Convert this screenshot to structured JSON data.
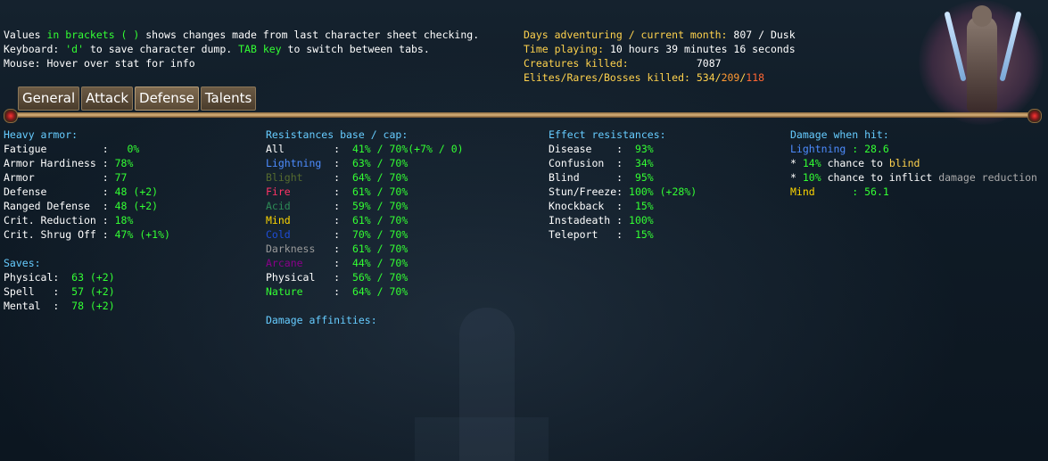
{
  "info": {
    "line1_a": "Values ",
    "line1_b": "in brackets ( )",
    "line1_c": " shows changes made from last character sheet checking.",
    "line2_a": "Keyboard: ",
    "line2_b": "'d'",
    "line2_c": " to save character dump. ",
    "line2_d": "TAB key",
    "line2_e": " to switch between tabs.",
    "line3": "Mouse: Hover over stat for info"
  },
  "stats": {
    "days_label": "Days adventuring / current month:",
    "days_value": " 807 / Dusk",
    "time_label": "Time playing:",
    "time_value": " 10 hours 39 minutes 16 seconds",
    "kills_label": "Creatures killed:",
    "kills_value": "           7087",
    "elites_label": "Elites/Rares/Bosses killed:",
    "elites_value": " 534",
    "rares_value": "209",
    "bosses_value": "118",
    "slash": "/"
  },
  "tabs": [
    {
      "label": "General"
    },
    {
      "label": "Attack"
    },
    {
      "label": "Defense"
    },
    {
      "label": "Talents"
    }
  ],
  "armor": {
    "heading": "Heavy armor:",
    "rows": [
      {
        "label": "Fatigue         :",
        "value": "   0%"
      },
      {
        "label": "Armor Hardiness :",
        "value": " 78%"
      },
      {
        "label": "Armor           :",
        "value": " 77"
      },
      {
        "label": "Defense         :",
        "value": " 48 (+2)"
      },
      {
        "label": "Ranged Defense  :",
        "value": " 48 (+2)"
      },
      {
        "label": "Crit. Reduction :",
        "value": " 18%"
      },
      {
        "label": "Crit. Shrug Off :",
        "value": " 47% (+1%)"
      }
    ]
  },
  "saves": {
    "heading": "Saves:",
    "rows": [
      {
        "label": "Physical:",
        "value": "  63 (+2)"
      },
      {
        "label": "Spell   :",
        "value": "  57 (+2)"
      },
      {
        "label": "Mental  :",
        "value": "  78 (+2)"
      }
    ]
  },
  "resistances": {
    "heading": "Resistances base / cap:",
    "rows": [
      {
        "label": "All",
        "sep": "        :",
        "value": "  41% / 70%(+7% / 0)",
        "color": "#ffffff"
      },
      {
        "label": "Lightning",
        "sep": "  :",
        "value": "  63% / 70%",
        "color": "#4d8cff"
      },
      {
        "label": "Blight",
        "sep": "     :",
        "value": "  64% / 70%",
        "color": "#556b2f"
      },
      {
        "label": "Fire",
        "sep": "       :",
        "value": "  61% / 70%",
        "color": "#ff3366"
      },
      {
        "label": "Acid",
        "sep": "       :",
        "value": "  59% / 70%",
        "color": "#2e8b57"
      },
      {
        "label": "Mind",
        "sep": "       :",
        "value": "  61% / 70%",
        "color": "#ffd700"
      },
      {
        "label": "Cold",
        "sep": "       :",
        "value": "  70% / 70%",
        "color": "#1e4dd8"
      },
      {
        "label": "Darkness",
        "sep": "   :",
        "value": "  61% / 70%",
        "color": "#9a9a9a"
      },
      {
        "label": "Arcane",
        "sep": "     :",
        "value": "  44% / 70%",
        "color": "#8b008b"
      },
      {
        "label": "Physical",
        "sep": "   :",
        "value": "  56% / 70%",
        "color": "#ffffff"
      },
      {
        "label": "Nature",
        "sep": "     :",
        "value": "  64% / 70%",
        "color": "#33ff33"
      }
    ],
    "affinities_heading": "Damage affinities:"
  },
  "effects": {
    "heading": "Effect resistances:",
    "rows": [
      {
        "label": "Disease    :",
        "value": "  93%"
      },
      {
        "label": "Confusion  :",
        "value": "  34%"
      },
      {
        "label": "Blind      :",
        "value": "  95%"
      },
      {
        "label": "Stun/Freeze:",
        "value": " 100% (+28%)"
      },
      {
        "label": "Knockback  :",
        "value": "  15%"
      },
      {
        "label": "Instadeath :",
        "value": " 100%"
      },
      {
        "label": "Teleport   :",
        "value": "  15%"
      }
    ]
  },
  "damage_when_hit": {
    "heading": "Damage when hit:",
    "lightning_label": "Lightning",
    "lightning_value": " : 28.6",
    "blind_star": "* ",
    "blind_pct": "14%",
    "blind_text": " chance to ",
    "blind_word": "blind",
    "inflict_star": "* ",
    "inflict_pct": "10%",
    "inflict_text": " chance to inflict ",
    "inflict_word": "damage reduction",
    "mind_label": "Mind",
    "mind_value": "      : 56.1"
  },
  "colors": {
    "heading": "#66ccff",
    "value": "#33ff33",
    "gold": "#ffd24d"
  }
}
